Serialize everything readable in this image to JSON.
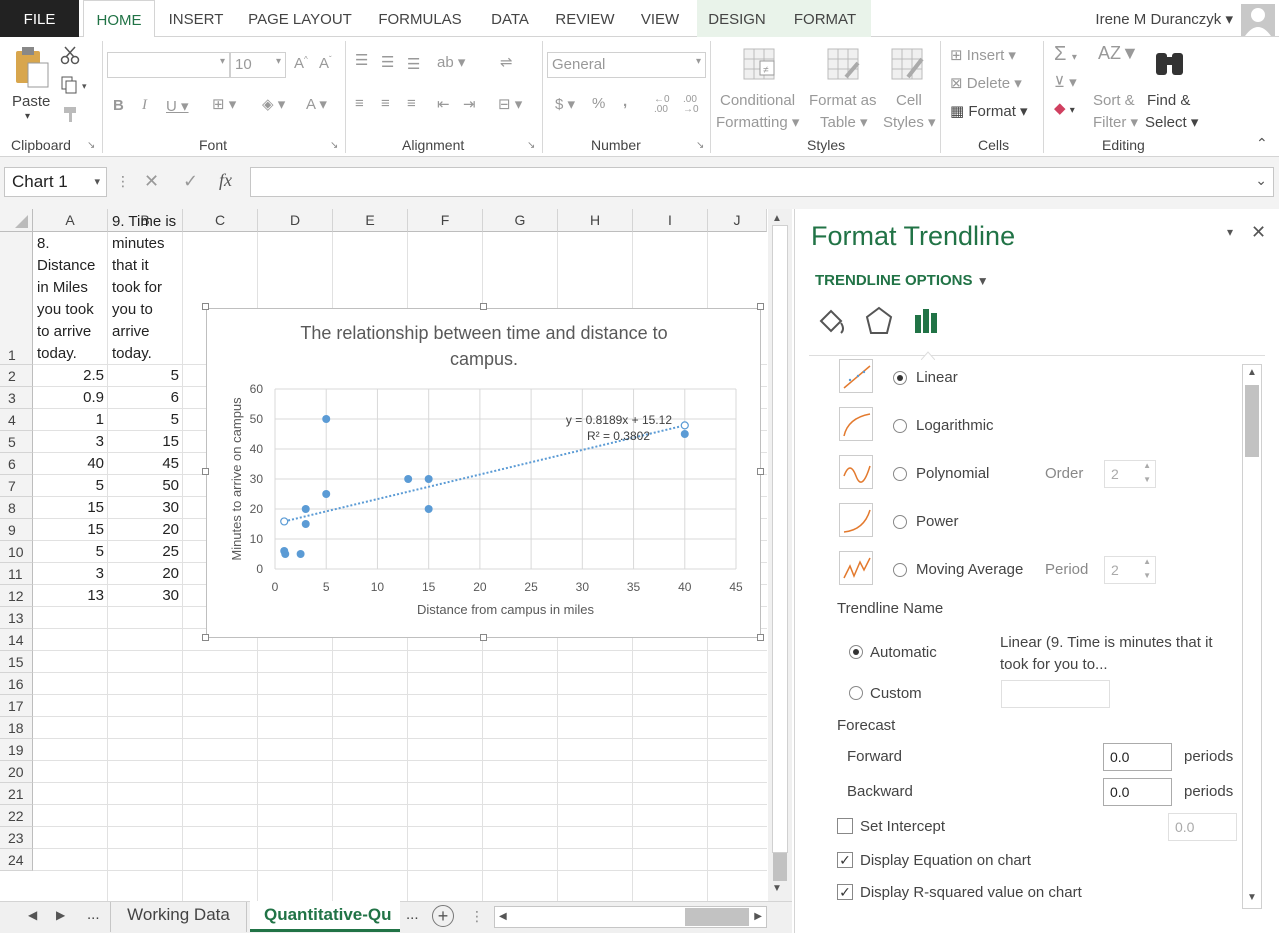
{
  "tabs": {
    "file": "FILE",
    "home": "HOME",
    "insert": "INSERT",
    "page_layout": "PAGE LAYOUT",
    "formulas": "FORMULAS",
    "data": "DATA",
    "review": "REVIEW",
    "view": "VIEW",
    "design": "DESIGN",
    "format": "FORMAT"
  },
  "user": {
    "name": "Irene M Duranczyk"
  },
  "ribbon": {
    "clipboard": {
      "label": "Clipboard",
      "paste": "Paste"
    },
    "font": {
      "label": "Font",
      "size": "10"
    },
    "alignment": {
      "label": "Alignment"
    },
    "number": {
      "label": "Number",
      "format": "General"
    },
    "styles": {
      "label": "Styles",
      "conditional_1": "Conditional",
      "conditional_2": "Formatting",
      "format_as_1": "Format as",
      "format_as_2": "Table",
      "cell_1": "Cell",
      "cell_2": "Styles"
    },
    "cells": {
      "label": "Cells",
      "insert": "Insert",
      "delete": "Delete",
      "format": "Format"
    },
    "editing": {
      "label": "Editing",
      "sort_1": "Sort &",
      "sort_2": "Filter",
      "find_1": "Find &",
      "find_2": "Select"
    }
  },
  "formula_bar": {
    "name_box": "Chart 1",
    "fx": "fx",
    "value": ""
  },
  "columns": [
    "A",
    "B",
    "C",
    "D",
    "E",
    "F",
    "G",
    "H",
    "I",
    "J"
  ],
  "rows": [
    "1",
    "2",
    "3",
    "4",
    "5",
    "6",
    "7",
    "8",
    "9",
    "10",
    "11",
    "12",
    "13",
    "14",
    "15",
    "16",
    "17",
    "18",
    "19",
    "20",
    "21",
    "22",
    "23",
    "24"
  ],
  "header_a": [
    "8.",
    "Distance",
    "in Miles",
    "you took",
    "to arrive",
    "today."
  ],
  "header_b": [
    "9. Time is",
    "minutes",
    "that it",
    "took for",
    "you to",
    "arrive",
    "today."
  ],
  "data_rows": [
    [
      "2.5",
      "5"
    ],
    [
      "0.9",
      "6"
    ],
    [
      "1",
      "5"
    ],
    [
      "3",
      "15"
    ],
    [
      "40",
      "45"
    ],
    [
      "5",
      "50"
    ],
    [
      "15",
      "30"
    ],
    [
      "15",
      "20"
    ],
    [
      "5",
      "25"
    ],
    [
      "3",
      "20"
    ],
    [
      "13",
      "30"
    ]
  ],
  "sheet_tabs": {
    "more_left": "...",
    "working": "Working Data",
    "active": "Quantitative-Qu",
    "more_right": "..."
  },
  "chart_data": {
    "type": "scatter",
    "title": "The relationship between time and distance to campus.",
    "xlabel": "Distance from campus in miles",
    "ylabel": "Minutes  to arrive on campus",
    "xlim": [
      0,
      45
    ],
    "ylim": [
      0,
      60
    ],
    "x_ticks": [
      "0",
      "5",
      "10",
      "15",
      "20",
      "25",
      "30",
      "35",
      "40",
      "45"
    ],
    "y_ticks": [
      "0",
      "10",
      "20",
      "30",
      "40",
      "50",
      "60"
    ],
    "grid": true,
    "series": [
      {
        "x": [
          2.5,
          0.9,
          1,
          3,
          40,
          5,
          15,
          15,
          5,
          3,
          13
        ],
        "y": [
          5,
          6,
          5,
          15,
          45,
          50,
          30,
          20,
          25,
          20,
          30
        ],
        "color": "#5b9bd5"
      }
    ],
    "trendline": {
      "type": "linear",
      "slope": 0.8189,
      "intercept": 15.12,
      "x_range": [
        0.9,
        40
      ],
      "equation": "y = 0.8189x + 15.12",
      "r_squared": "R² = 0.3802"
    }
  },
  "pane": {
    "title": "Format Trendline",
    "section": "TRENDLINE OPTIONS",
    "options": {
      "linear": "Linear",
      "logarithmic": "Logarithmic",
      "polynomial": "Polynomial",
      "power": "Power",
      "moving_average": "Moving Average"
    },
    "order_label": "Order",
    "order_value": "2",
    "period_label": "Period",
    "period_value": "2",
    "name_label": "Trendline Name",
    "automatic": "Automatic",
    "custom": "Custom",
    "auto_name_1": "Linear (9. Time is minutes that it",
    "auto_name_2": "took for you to...",
    "forecast": "Forecast",
    "forward": "Forward",
    "backward": "Backward",
    "forward_value": "0.0",
    "backward_value": "0.0",
    "periods": "periods",
    "set_intercept": "Set Intercept",
    "intercept_value": "0.0",
    "display_equation": "Display Equation on chart",
    "display_r2": "Display R-squared value on chart"
  }
}
